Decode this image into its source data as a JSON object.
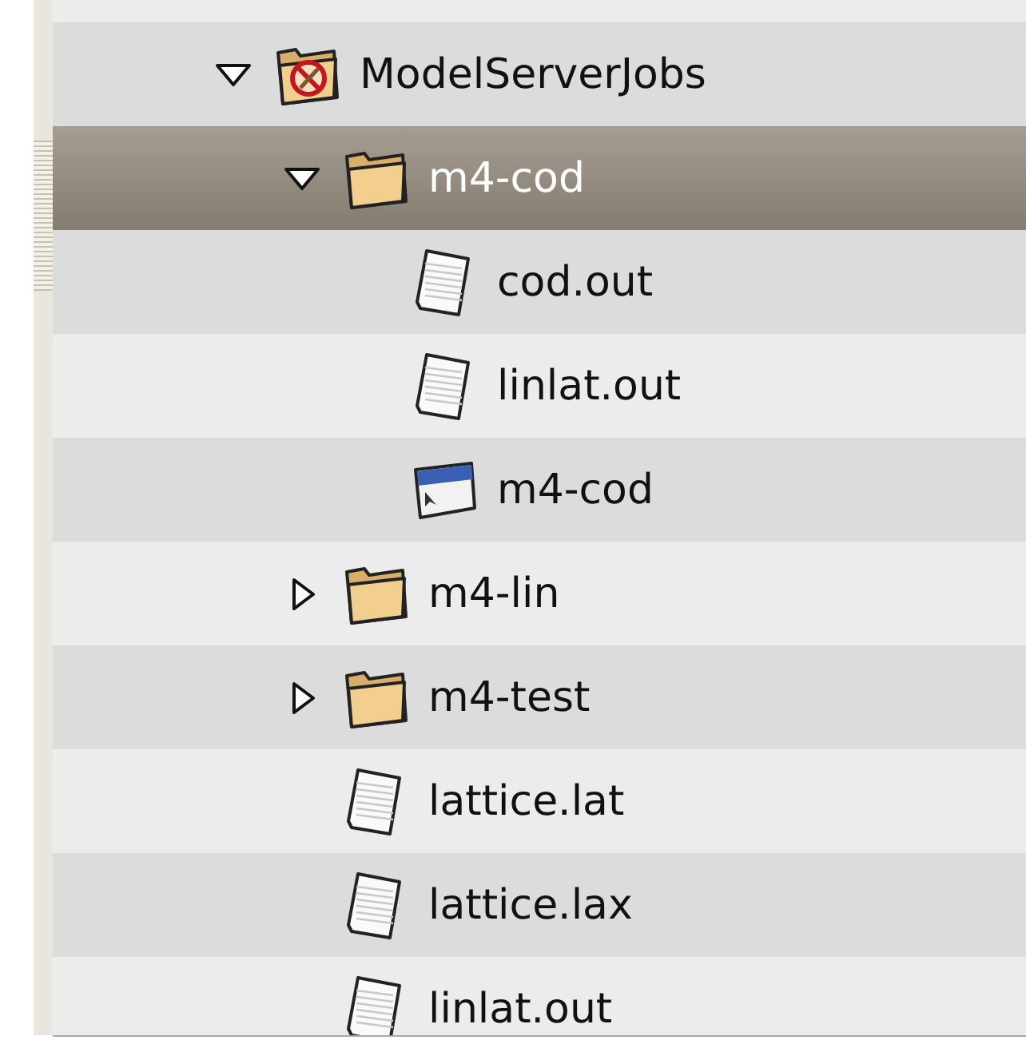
{
  "tree": [
    {
      "label": "ModelServerJobs",
      "kind": "special",
      "expanded": true,
      "selected": false,
      "children": [
        {
          "label": "m4-cod",
          "kind": "folder",
          "expanded": true,
          "selected": true,
          "children": [
            {
              "label": "cod.out",
              "kind": "file",
              "selected": false
            },
            {
              "label": "linlat.out",
              "kind": "file",
              "selected": false
            },
            {
              "label": "m4-cod",
              "kind": "executable",
              "selected": false
            }
          ]
        },
        {
          "label": "m4-lin",
          "kind": "folder",
          "expanded": false,
          "selected": false
        },
        {
          "label": "m4-test",
          "kind": "folder",
          "expanded": false,
          "selected": false
        },
        {
          "label": "lattice.lat",
          "kind": "file",
          "selected": false
        },
        {
          "label": "lattice.lax",
          "kind": "file",
          "selected": false
        },
        {
          "label": "linlat.out",
          "kind": "file",
          "selected": false
        }
      ]
    }
  ]
}
